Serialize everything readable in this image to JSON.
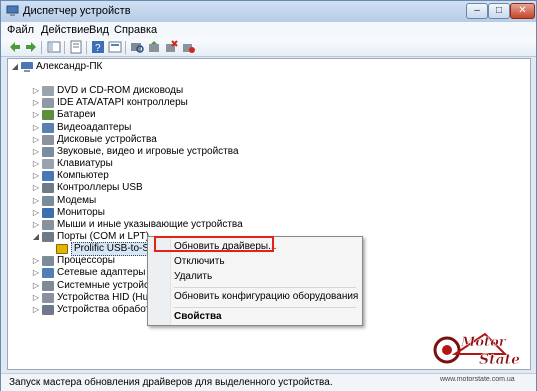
{
  "window": {
    "title": "Диспетчер устройств"
  },
  "menubar": {
    "items": [
      "Файл",
      "Действие",
      "Вид",
      "Справка"
    ]
  },
  "tree": {
    "root": "Александр-ПК",
    "items": [
      {
        "label": "DVD и CD-ROM дисководы",
        "icon": "dvd-drive-icon",
        "color": "#9aa3ad"
      },
      {
        "label": "IDE ATA/ATAPI контроллеры",
        "icon": "ide-controller-icon",
        "color": "#8f9aa6"
      },
      {
        "label": "Батареи",
        "icon": "battery-icon",
        "color": "#5f8f3c"
      },
      {
        "label": "Видеоадаптеры",
        "icon": "display-adapter-icon",
        "color": "#5a7fb0"
      },
      {
        "label": "Дисковые устройства",
        "icon": "disk-drive-icon",
        "color": "#8a929c"
      },
      {
        "label": "Звуковые, видео и игровые устройства",
        "icon": "sound-icon",
        "color": "#7a8c9e"
      },
      {
        "label": "Клавиатуры",
        "icon": "keyboard-icon",
        "color": "#9aa3ad"
      },
      {
        "label": "Компьютер",
        "icon": "computer-icon",
        "color": "#4a78b5"
      },
      {
        "label": "Контроллеры USB",
        "icon": "usb-icon",
        "color": "#6e7a88"
      },
      {
        "label": "Модемы",
        "icon": "modem-icon",
        "color": "#7d8a99"
      },
      {
        "label": "Мониторы",
        "icon": "monitor-icon",
        "color": "#3f6fae"
      },
      {
        "label": "Мыши и иные указывающие устройства",
        "icon": "mouse-icon",
        "color": "#8a929c"
      },
      {
        "label": "Порты (COM и LPT)",
        "icon": "port-icon",
        "color": "#6e7a88"
      },
      {
        "label": "Prolific USB-to-Serial Comm Port (COM29)",
        "icon": "warning-device-icon",
        "color": "#e0b400"
      },
      {
        "label": "Процессоры",
        "icon": "processor-icon",
        "color": "#7d8a99"
      },
      {
        "label": "Сетевые адаптеры",
        "icon": "network-adapter-icon",
        "color": "#4f7fb5"
      },
      {
        "label": "Системные устройства",
        "icon": "system-device-icon",
        "color": "#7d8a99"
      },
      {
        "label": "Устройства HID (Human Int",
        "icon": "hid-icon",
        "color": "#8a929c"
      },
      {
        "label": "Устройства обработки изо",
        "icon": "imaging-icon",
        "color": "#6e7a88"
      }
    ]
  },
  "context_menu": {
    "update": "Обновить драйверы...",
    "disable": "Отключить",
    "remove": "Удалить",
    "scan": "Обновить конфигурацию оборудования",
    "properties": "Свойства"
  },
  "statusbar": {
    "text": "Запуск мастера обновления драйверов для выделенного устройства."
  },
  "watermark": {
    "brand": "Motor State",
    "url": "www.motorstate.com.ua"
  },
  "colors": {
    "highlight": "#e2231a",
    "title": "#b7cde6"
  }
}
